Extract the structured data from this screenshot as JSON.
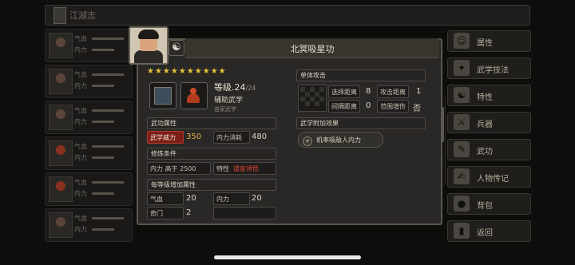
{
  "top_bar": {
    "title": "江湖志"
  },
  "roster": [
    {
      "stat1": "气血",
      "stat2": "内力"
    },
    {
      "stat1": "气血",
      "stat2": "内力"
    },
    {
      "stat1": "气血",
      "stat2": "内力"
    },
    {
      "stat1": "气血",
      "stat2": "内力"
    },
    {
      "stat1": "气血",
      "stat2": "内力"
    },
    {
      "stat1": "气血",
      "stat2": "内力"
    }
  ],
  "sidebar": {
    "items": [
      {
        "label": "属性",
        "icon": "person-icon"
      },
      {
        "label": "武学技法",
        "icon": "martial-art-icon"
      },
      {
        "label": "特性",
        "icon": "trait-icon"
      },
      {
        "label": "兵器",
        "icon": "sword-icon"
      },
      {
        "label": "武功",
        "icon": "scroll-icon"
      },
      {
        "label": "人物传记",
        "icon": "biography-icon"
      },
      {
        "label": "背包",
        "icon": "bag-icon"
      },
      {
        "label": "返回",
        "icon": "return-icon"
      }
    ]
  },
  "skill": {
    "title": "北冥吸星功",
    "stars": "★★★★★★★★★★",
    "level_label": "等级.",
    "level": "24",
    "level_max": "/24",
    "type": "辅助武学",
    "school": "道家武学"
  },
  "attributes": {
    "header": "武功属性",
    "power_label": "武学威力",
    "power_value": "350",
    "mp_cost_label": "内力消耗",
    "mp_cost_value": "480"
  },
  "requirements": {
    "header": "修炼条件",
    "mp_req": "内力 高于 2500",
    "trait_label": "特性",
    "trait_value": "道家领悟"
  },
  "per_level": {
    "header": "每等级增加属性",
    "rows": [
      {
        "label": "气血",
        "value": "20",
        "label2": "内力",
        "value2": "20"
      },
      {
        "label": "奇门",
        "value": "2",
        "label2": "",
        "value2": ""
      }
    ]
  },
  "single_attack": {
    "header": "单体攻击",
    "select_range_label": "选择距离",
    "select_range_value": "8",
    "attack_range_label": "攻击距离",
    "attack_range_value": "1",
    "interval_label": "间隔距离",
    "interval_value": "0",
    "spread_label": "范围增伤",
    "spread_value": "否"
  },
  "effects": {
    "header": "武学附加效果",
    "passive_icon": "+",
    "passive": "机率吸敌人内力"
  },
  "colors": {
    "accent_red": "#7b1f19",
    "gold": "#e2b24c",
    "star": "#e8c23a"
  }
}
